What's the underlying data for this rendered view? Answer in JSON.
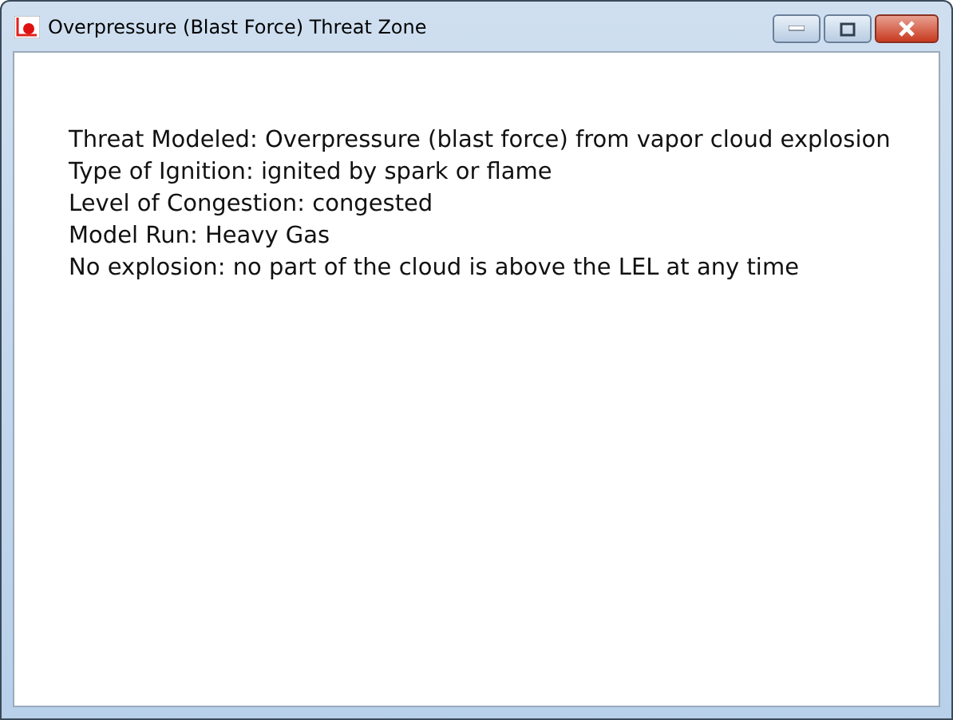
{
  "window": {
    "title": "Overpressure (Blast Force) Threat Zone"
  },
  "lines": [
    "Threat Modeled: Overpressure (blast force) from vapor cloud explosion",
    "Type of Ignition: ignited by spark or flame",
    "Level of Congestion: congested",
    "Model Run: Heavy Gas",
    "No explosion: no part of the cloud is above the LEL at any time"
  ]
}
